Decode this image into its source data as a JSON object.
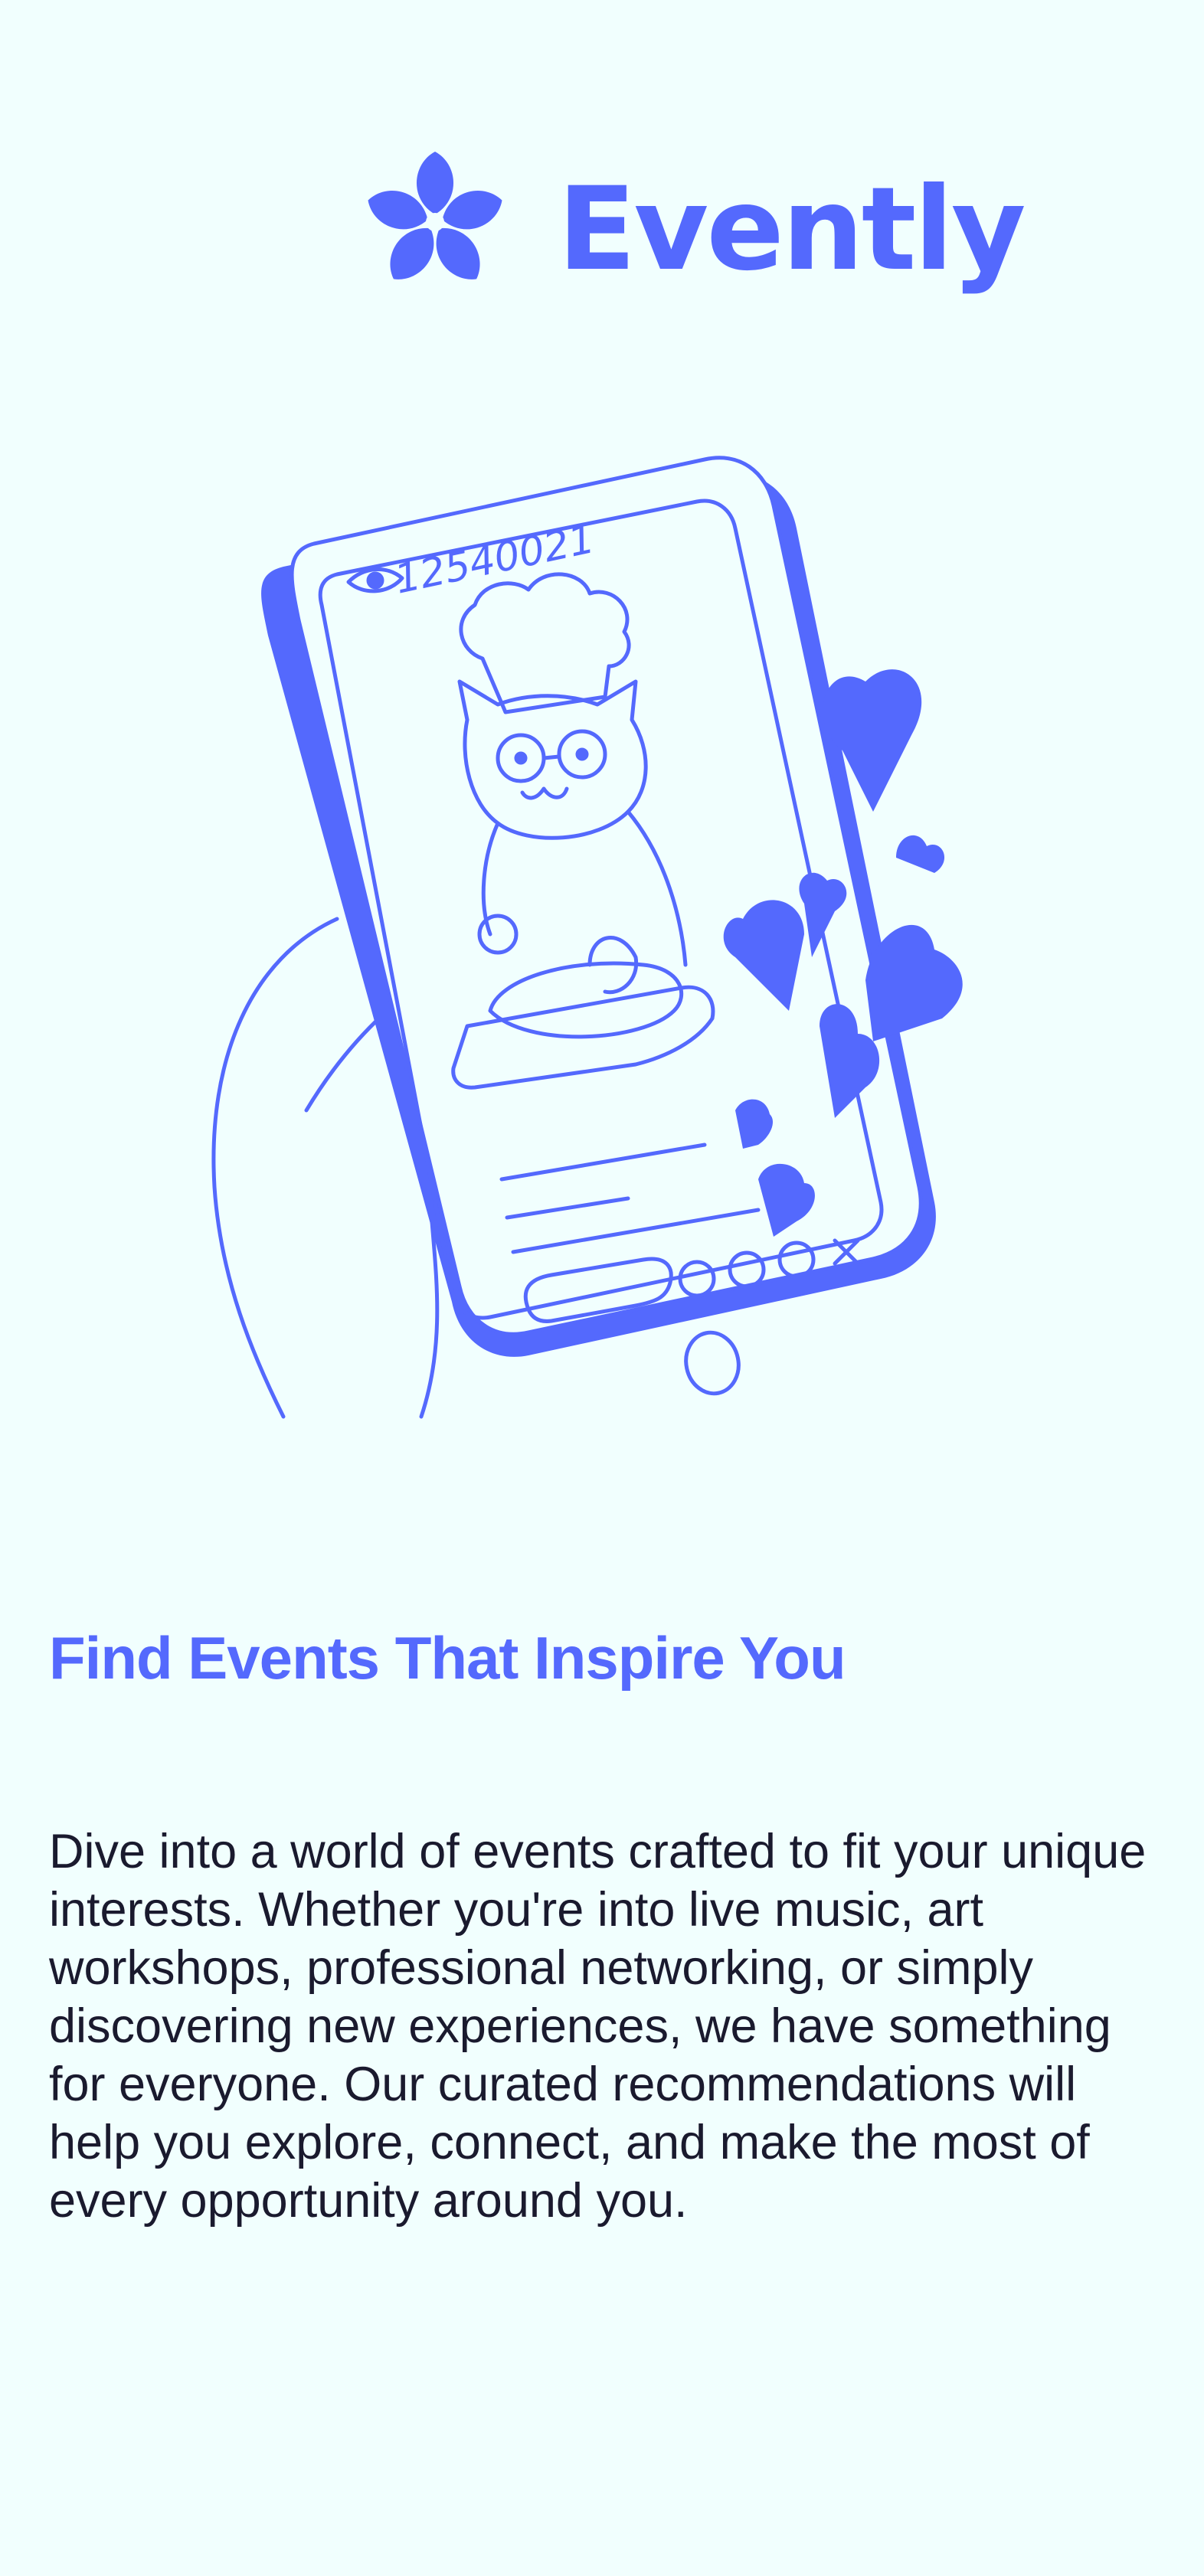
{
  "brand": {
    "name": "Evently",
    "logo_icon": "flower-logo-icon",
    "color": "#5469FD"
  },
  "illustration": {
    "view_count": "12540021",
    "icons": [
      "eye-icon",
      "chef-cat",
      "bread",
      "heart-icon",
      "gift-icon",
      "close-icon",
      "home-button"
    ]
  },
  "content": {
    "title": "Find Events That Inspire You",
    "description": "Dive into a world of events crafted to fit your unique interests. Whether you're into live music, art workshops, professional networking, or simply discovering new experiences, we have something for everyone. Our curated recommendations will help you explore, connect, and make the most of every opportunity around you."
  },
  "colors": {
    "background": "#F1FFFE",
    "accent": "#5469FD",
    "text": "#1A1A2E"
  }
}
